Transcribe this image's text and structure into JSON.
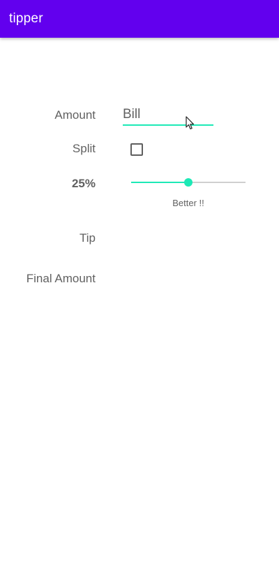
{
  "appbar": {
    "title": "tipper",
    "color": "#6200EE"
  },
  "form": {
    "amount_label": "Amount",
    "bill_placeholder": "Bill",
    "bill_value": "",
    "split_label": "Split",
    "split_checked": false,
    "tip_percent_label": "25%",
    "tip_percent_value": 25,
    "slider_fraction": 0.5,
    "tip_description": "Better !!",
    "tip_label": "Tip",
    "final_amount_label": "Final Amount"
  },
  "colors": {
    "accent": "#1DE9B6",
    "text": "#616161"
  }
}
